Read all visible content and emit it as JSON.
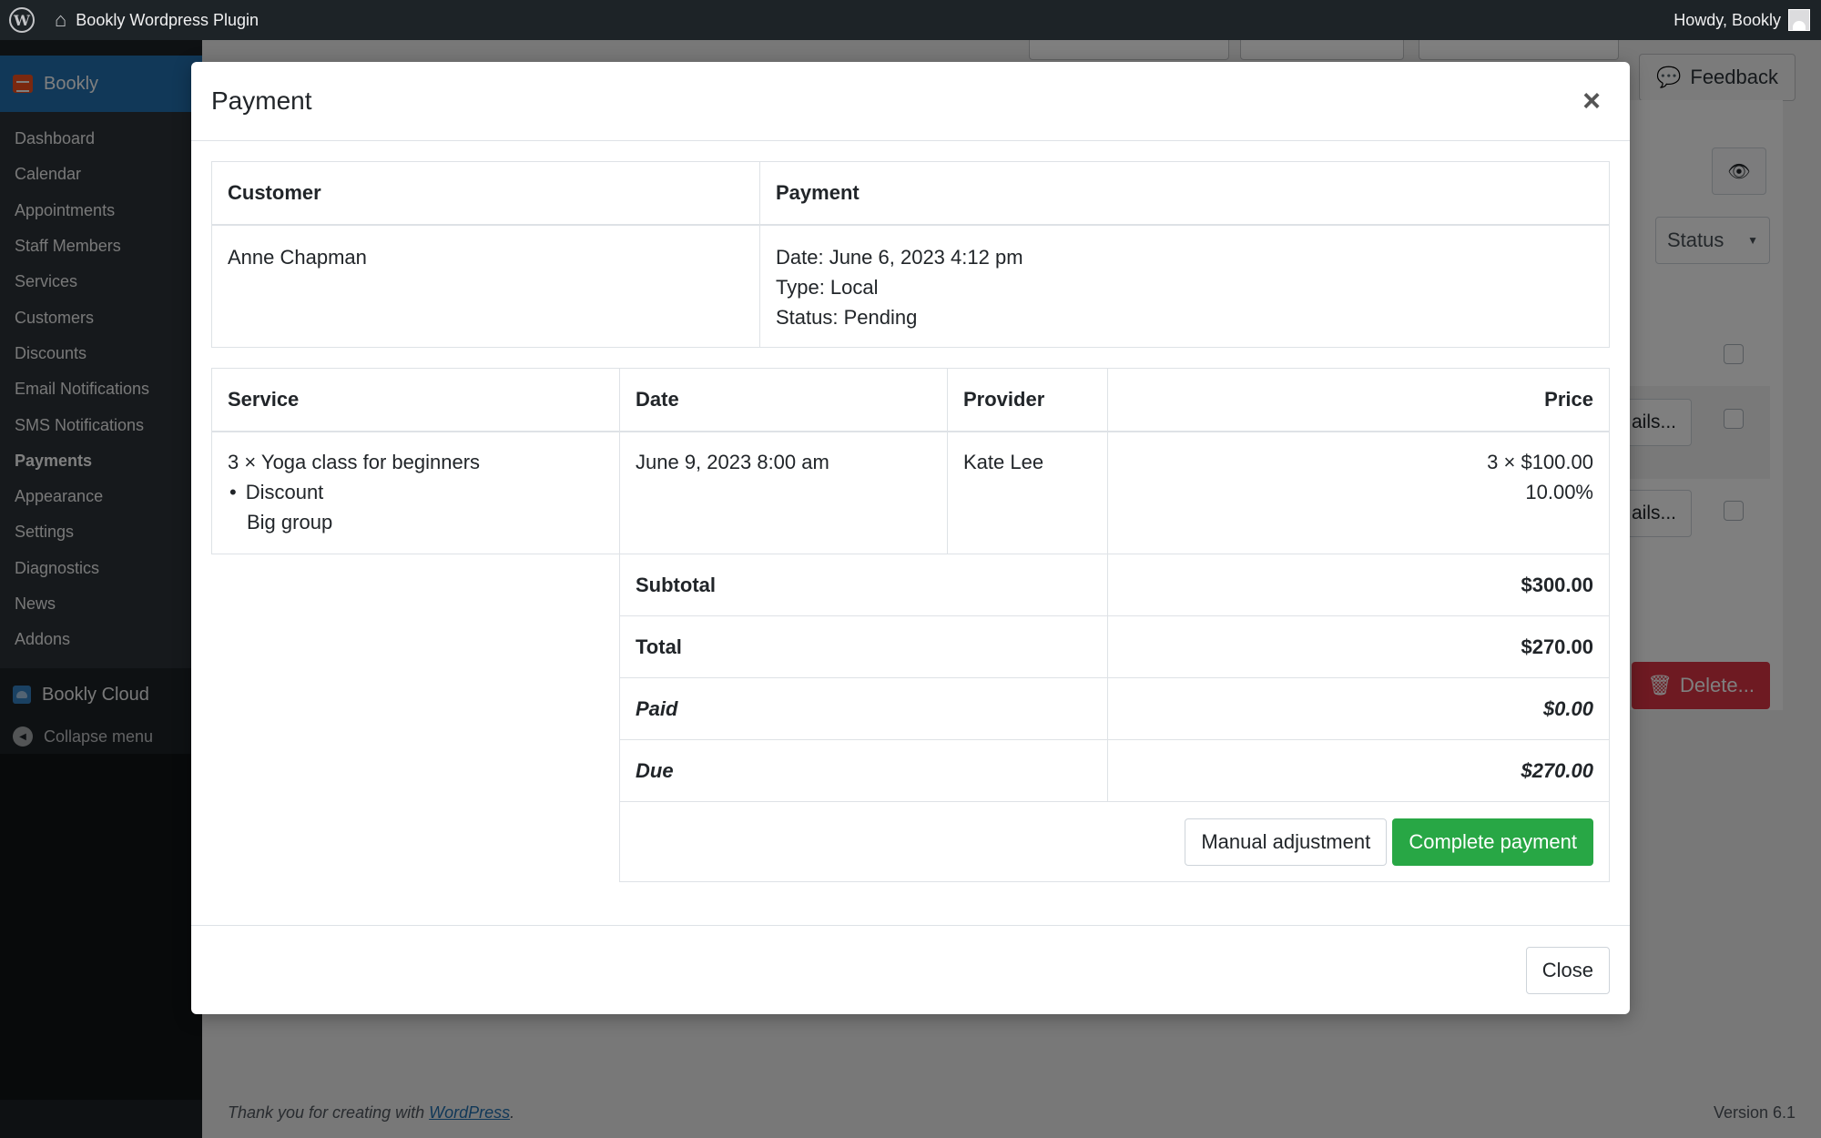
{
  "adminbar": {
    "site_name": "Bookly Wordpress Plugin",
    "greeting": "Howdy, Bookly"
  },
  "sidebar": {
    "plugin_name": "Bookly",
    "items": [
      {
        "label": "Dashboard"
      },
      {
        "label": "Calendar"
      },
      {
        "label": "Appointments"
      },
      {
        "label": "Staff Members"
      },
      {
        "label": "Services"
      },
      {
        "label": "Customers"
      },
      {
        "label": "Discounts"
      },
      {
        "label": "Email Notifications"
      },
      {
        "label": "SMS Notifications"
      },
      {
        "label": "Payments"
      },
      {
        "label": "Appearance"
      },
      {
        "label": "Settings"
      },
      {
        "label": "Diagnostics"
      },
      {
        "label": "News"
      },
      {
        "label": "Addons"
      }
    ],
    "current": "Payments",
    "cloud_label": "Bookly Cloud",
    "collapse_label": "Collapse menu"
  },
  "background": {
    "feedback_label": "Feedback",
    "status_label": "Status",
    "details_label": "ails...",
    "delete_label": "Delete...",
    "footer_text": "Thank you for creating with ",
    "footer_link": "WordPress",
    "footer_period": ".",
    "version": "Version 6.1"
  },
  "modal": {
    "title": "Payment",
    "close_symbol": "×",
    "info_table": {
      "customer_header": "Customer",
      "payment_header": "Payment",
      "customer_name": "Anne Chapman",
      "payment_date": "Date: June 6, 2023 4:12 pm",
      "payment_type": "Type: Local",
      "payment_status": "Status: Pending"
    },
    "items_table": {
      "headers": {
        "service": "Service",
        "date": "Date",
        "provider": "Provider",
        "price": "Price"
      },
      "rows": [
        {
          "service": "3 × Yoga class for beginners",
          "discount_label": "Discount",
          "discount_name": "Big group",
          "date": "June 9, 2023 8:00 am",
          "provider": "Kate Lee",
          "price": "3 × $100.00",
          "discount_value": "10.00%"
        }
      ],
      "summary": [
        {
          "label": "Subtotal",
          "value": "$300.00",
          "italic": false
        },
        {
          "label": "Total",
          "value": "$270.00",
          "italic": false
        },
        {
          "label": "Paid",
          "value": "$0.00",
          "italic": true
        },
        {
          "label": "Due",
          "value": "$270.00",
          "italic": true
        }
      ]
    },
    "manual_adjustment_label": "Manual adjustment",
    "complete_payment_label": "Complete payment",
    "footer_close_label": "Close"
  },
  "colors": {
    "wp_admin_bar": "#1d2327",
    "wp_accent": "#2271b1",
    "success": "#28a745",
    "danger": "#dc3545"
  }
}
